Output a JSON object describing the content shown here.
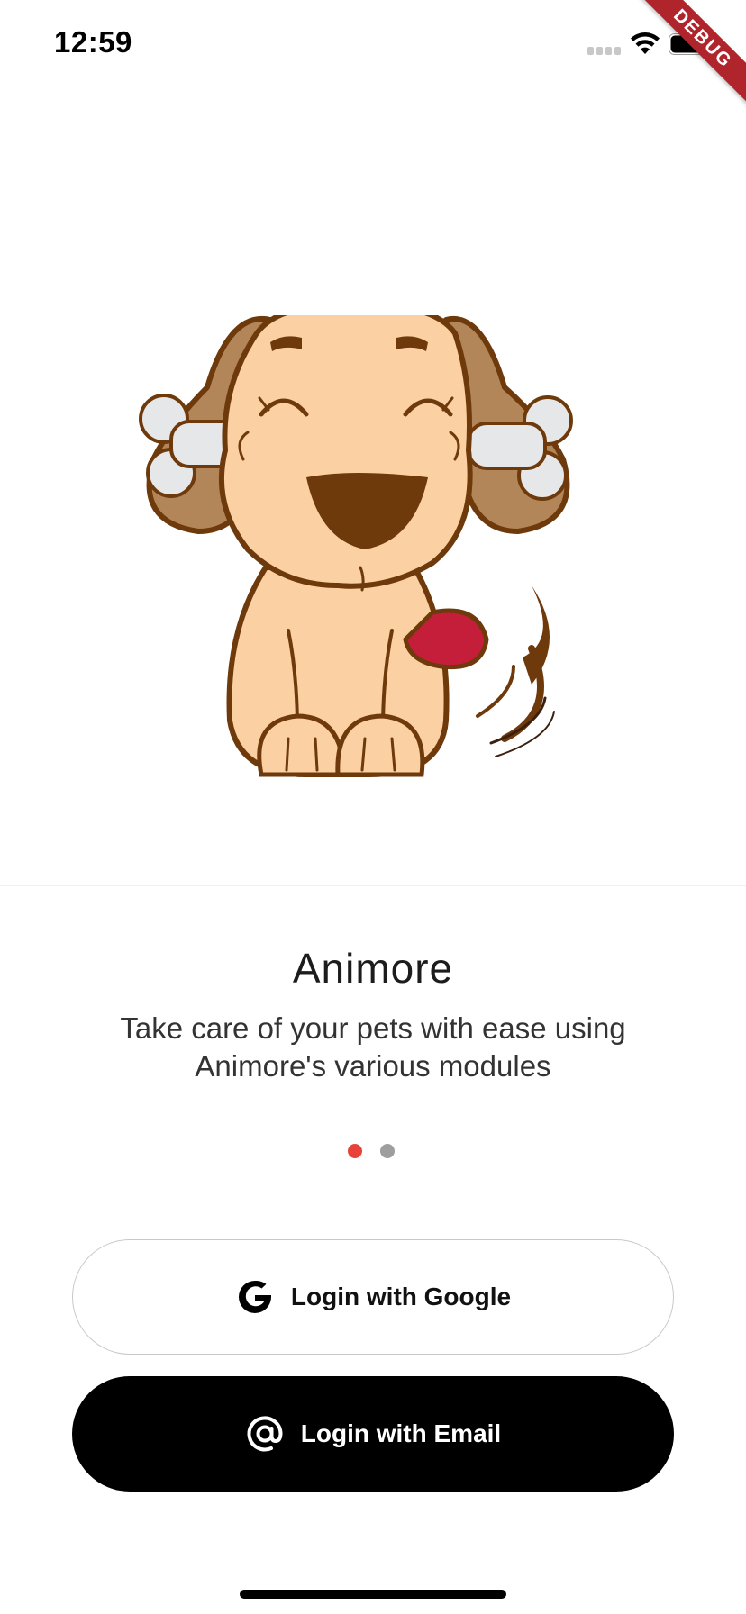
{
  "status_bar": {
    "time": "12:59"
  },
  "debug_banner": {
    "label": "DEBUG"
  },
  "onboarding": {
    "title": "Animore",
    "subtitle": "Take care of your pets with ease using Animore's various modules",
    "pagination": {
      "count": 2,
      "active_index": 0,
      "active_color": "#e8433a",
      "inactive_color": "#9e9e9e"
    }
  },
  "actions": {
    "google_label": "Login with Google",
    "email_label": "Login with Email",
    "google_icon": "google-g-icon",
    "email_icon": "at-sign-icon"
  }
}
